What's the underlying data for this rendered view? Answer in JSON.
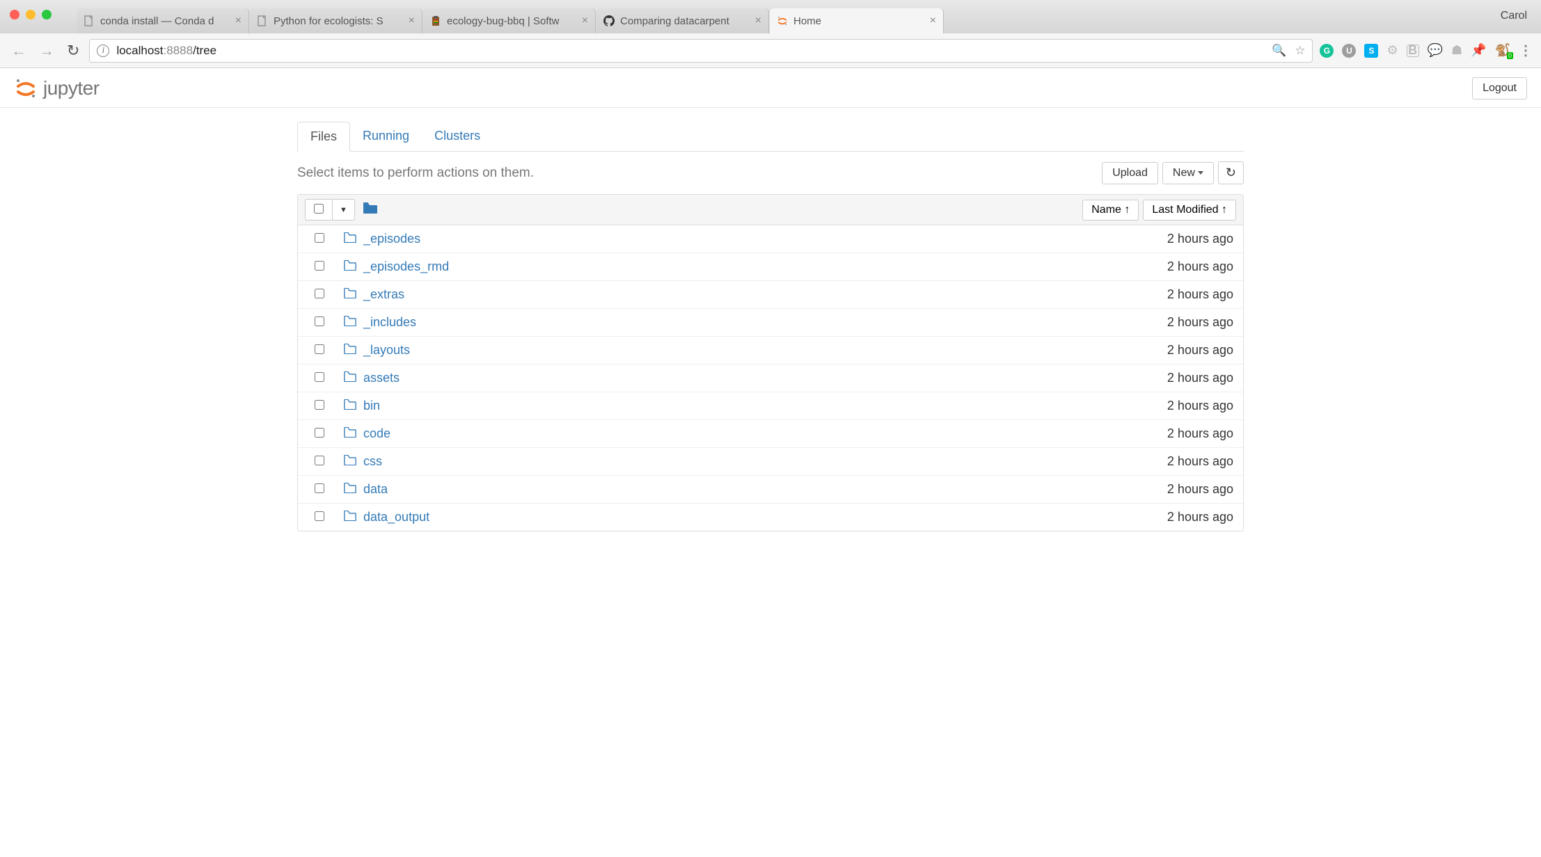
{
  "chrome": {
    "user": "Carol",
    "tabs": [
      {
        "title": "conda install — Conda d",
        "favicon": "page"
      },
      {
        "title": "Python for ecologists: S",
        "favicon": "page"
      },
      {
        "title": "ecology-bug-bbq | Softw",
        "favicon": "clipboard"
      },
      {
        "title": "Comparing datacarpent",
        "favicon": "github"
      },
      {
        "title": "Home",
        "favicon": "jupyter",
        "active": true
      }
    ],
    "url": {
      "host": "localhost",
      "port": ":8888",
      "path": "/tree"
    }
  },
  "jupyter": {
    "logo": "jupyter",
    "logout": "Logout",
    "tabs": {
      "files": "Files",
      "running": "Running",
      "clusters": "Clusters",
      "active": "files"
    },
    "action_label": "Select items to perform actions on them.",
    "upload": "Upload",
    "new": "New",
    "sort_name": "Name",
    "sort_modified": "Last Modified",
    "files": [
      {
        "name": "_episodes",
        "type": "folder",
        "modified": "2 hours ago"
      },
      {
        "name": "_episodes_rmd",
        "type": "folder",
        "modified": "2 hours ago"
      },
      {
        "name": "_extras",
        "type": "folder",
        "modified": "2 hours ago"
      },
      {
        "name": "_includes",
        "type": "folder",
        "modified": "2 hours ago"
      },
      {
        "name": "_layouts",
        "type": "folder",
        "modified": "2 hours ago"
      },
      {
        "name": "assets",
        "type": "folder",
        "modified": "2 hours ago"
      },
      {
        "name": "bin",
        "type": "folder",
        "modified": "2 hours ago"
      },
      {
        "name": "code",
        "type": "folder",
        "modified": "2 hours ago"
      },
      {
        "name": "css",
        "type": "folder",
        "modified": "2 hours ago"
      },
      {
        "name": "data",
        "type": "folder",
        "modified": "2 hours ago"
      },
      {
        "name": "data_output",
        "type": "folder",
        "modified": "2 hours ago"
      }
    ]
  }
}
